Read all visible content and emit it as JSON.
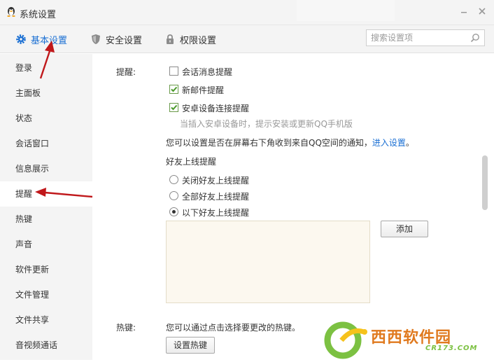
{
  "window": {
    "title": "系统设置",
    "close_icon": "close-icon",
    "minimize_icon": "minimize-icon"
  },
  "topnav": {
    "tabs": [
      {
        "label": "基本设置",
        "icon": "gear-icon",
        "active": true
      },
      {
        "label": "安全设置",
        "icon": "shield-icon",
        "active": false
      },
      {
        "label": "权限设置",
        "icon": "lock-icon",
        "active": false
      }
    ],
    "search_placeholder": "搜索设置项"
  },
  "sidebar": {
    "items": [
      {
        "label": "登录"
      },
      {
        "label": "主面板"
      },
      {
        "label": "状态"
      },
      {
        "label": "会话窗口"
      },
      {
        "label": "信息展示"
      },
      {
        "label": "提醒",
        "active": true
      },
      {
        "label": "热键"
      },
      {
        "label": "声音"
      },
      {
        "label": "软件更新"
      },
      {
        "label": "文件管理"
      },
      {
        "label": "文件共享"
      },
      {
        "label": "音视频通话"
      }
    ]
  },
  "reminder": {
    "section_label": "提醒:",
    "options": [
      {
        "label": "会话消息提醒",
        "checked": false
      },
      {
        "label": "新邮件提醒",
        "checked": true
      },
      {
        "label": "安卓设备连接提醒",
        "checked": true
      }
    ],
    "android_hint": "当插入安卓设备时，提示安装或更新QQ手机版",
    "qzone_text": "您可以设置是否在屏幕右下角收到来自QQ空间的通知，",
    "qzone_link": "进入设置",
    "qzone_period": "。",
    "friend_online_title": "好友上线提醒",
    "friend_options": [
      {
        "label": "关闭好友上线提醒",
        "selected": false
      },
      {
        "label": "全部好友上线提醒",
        "selected": false
      },
      {
        "label": "以下好友上线提醒",
        "selected": true
      }
    ],
    "add_button": "添加"
  },
  "hotkey": {
    "section_label": "热键:",
    "description": "您可以通过点击选择要更改的热键。",
    "set_button": "设置热键"
  },
  "watermark": {
    "text": "西西软件园",
    "url": "CR173.COM"
  },
  "colors": {
    "accent": "#1a6fd3",
    "arrow": "#c0181b",
    "checkbox_green": "#4a9a2a"
  }
}
